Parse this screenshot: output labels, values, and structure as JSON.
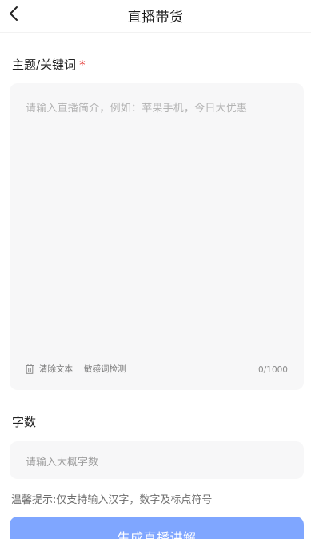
{
  "header": {
    "title": "直播带货",
    "back_icon": "chevron-left-icon"
  },
  "topic_field": {
    "label": "主题/关键词",
    "required_mark": "*",
    "placeholder": "请输入直播简介，例如：苹果手机，今日大优惠",
    "value": "",
    "clear_label": "清除文本",
    "clear_icon": "trash-icon",
    "sensitive_check_label": "敏感词检测",
    "char_count": "0/1000"
  },
  "word_count_field": {
    "label": "字数",
    "placeholder": "请输入大概字数",
    "value": ""
  },
  "hint": "温馨提示:仅支持输入汉字，数字及标点符号",
  "submit": {
    "label": "生成直播讲解"
  },
  "colors": {
    "accent": "#7fa6ff",
    "required": "#e53935",
    "field_background": "#f7f7f8"
  }
}
